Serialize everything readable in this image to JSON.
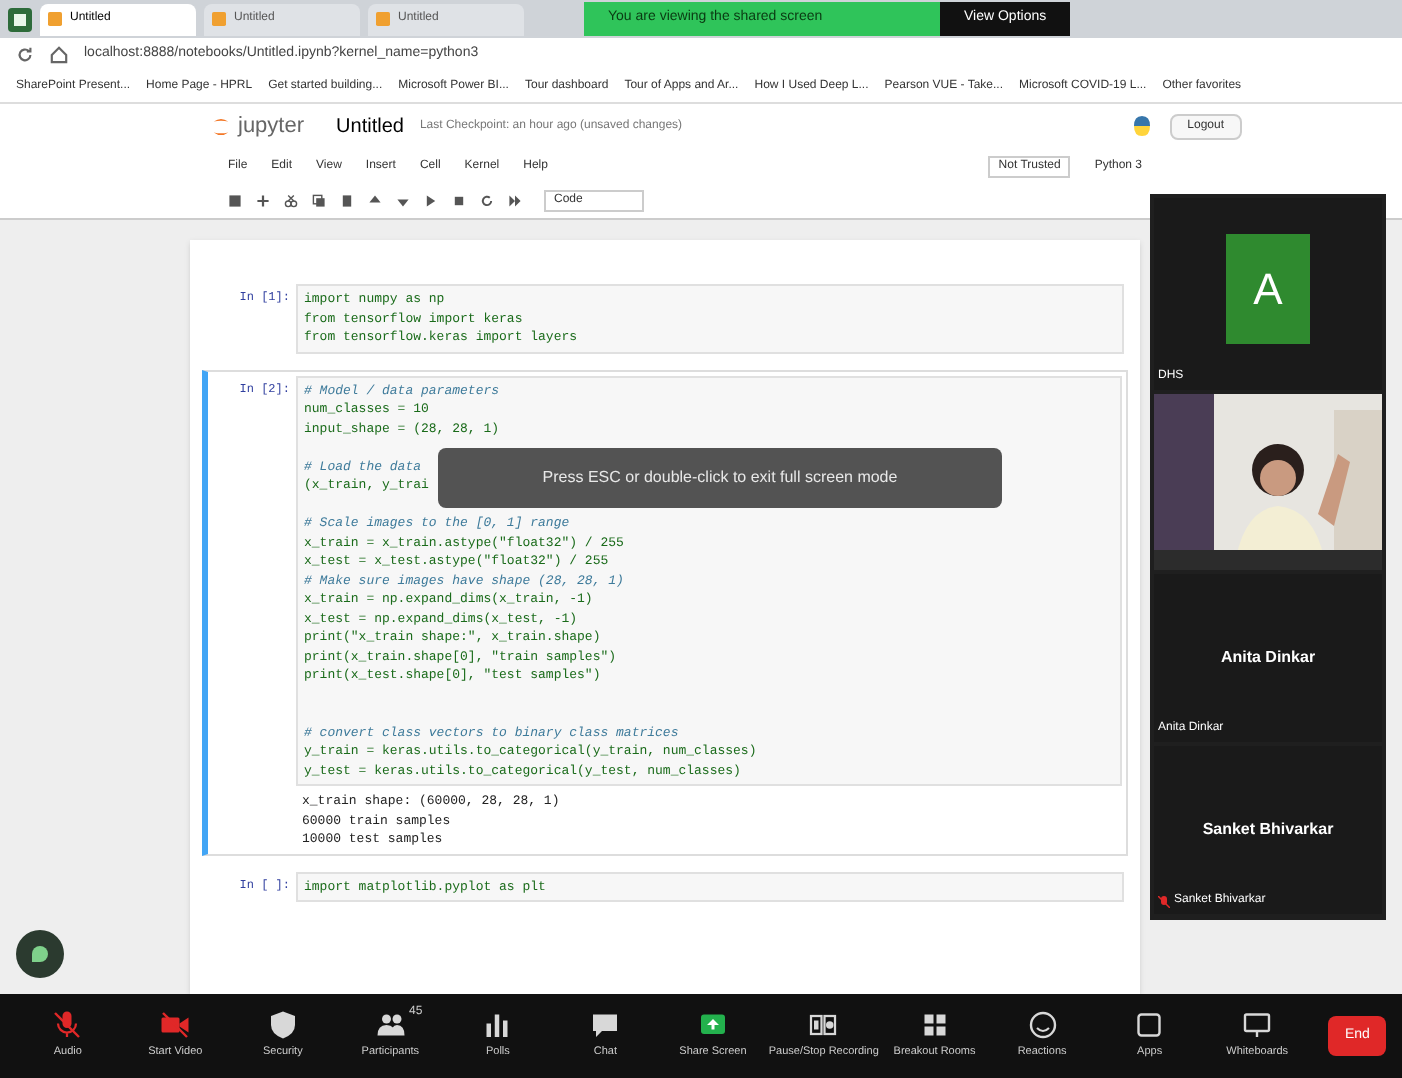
{
  "browser": {
    "tabs": [
      {
        "label": "Untitled",
        "selected": true
      },
      {
        "label": "Untitled",
        "selected": false
      },
      {
        "label": "Untitled",
        "selected": false
      }
    ],
    "address": "localhost:8888/notebooks/Untitled.ipynb?kernel_name=python3",
    "bookmarks": [
      "SharePoint Present...",
      "Home Page - HPRL",
      "Get started building...",
      "Microsoft Power BI...",
      "Tour dashboard",
      "Tour of Apps and Ar...",
      "How I Used Deep L...",
      "Pearson VUE - Take...",
      "Microsoft COVID-19 L...",
      "Other favorites"
    ]
  },
  "share_banner": {
    "text": "You are viewing the shared screen",
    "button": "View Options"
  },
  "notebook": {
    "logo": "jupyter",
    "title": "Untitled",
    "checkpoint": "Last Checkpoint: an hour ago  (unsaved changes)",
    "logout": "Logout",
    "menu": [
      "File",
      "Edit",
      "View",
      "Insert",
      "Cell",
      "Kernel",
      "Help"
    ],
    "trusted": "Not Trusted",
    "kernel": "Python 3",
    "cell_type": "Code",
    "cells": [
      {
        "prompt": "In [1]:",
        "selected": false,
        "lines": [
          {
            "kind": "code",
            "text": "import numpy as np"
          },
          {
            "kind": "code",
            "text": "from tensorflow import keras"
          },
          {
            "kind": "code",
            "text": "from tensorflow.keras import layers"
          }
        ]
      },
      {
        "prompt": "In [2]:",
        "selected": true,
        "lines": [
          {
            "kind": "comment",
            "text": "# Model / data parameters"
          },
          {
            "kind": "code",
            "text": "num_classes = 10"
          },
          {
            "kind": "code",
            "text": "input_shape = (28, 28, 1)"
          },
          {
            "kind": "blank"
          },
          {
            "kind": "comment",
            "text": "# Load the data "
          },
          {
            "kind": "code",
            "text": "(x_train, y_trai"
          },
          {
            "kind": "blank"
          },
          {
            "kind": "comment",
            "text": "# Scale images to the [0, 1] range"
          },
          {
            "kind": "code",
            "text": "x_train = x_train.astype(\"float32\") / 255"
          },
          {
            "kind": "code",
            "text": "x_test = x_test.astype(\"float32\") / 255"
          },
          {
            "kind": "comment",
            "text": "# Make sure images have shape (28, 28, 1)"
          },
          {
            "kind": "code",
            "text": "x_train = np.expand_dims(x_train, -1)"
          },
          {
            "kind": "code",
            "text": "x_test = np.expand_dims(x_test, -1)"
          },
          {
            "kind": "code",
            "text": "print(\"x_train shape:\", x_train.shape)"
          },
          {
            "kind": "code",
            "text": "print(x_train.shape[0], \"train samples\")"
          },
          {
            "kind": "code",
            "text": "print(x_test.shape[0], \"test samples\")"
          },
          {
            "kind": "blank"
          },
          {
            "kind": "blank"
          },
          {
            "kind": "comment",
            "text": "# convert class vectors to binary class matrices"
          },
          {
            "kind": "code",
            "text": "y_train = keras.utils.to_categorical(y_train, num_classes)"
          },
          {
            "kind": "code",
            "text": "y_test = keras.utils.to_categorical(y_test, num_classes)"
          }
        ],
        "output": [
          "x_train shape: (60000, 28, 28, 1)",
          "60000 train samples",
          "10000 test samples"
        ]
      },
      {
        "prompt": "In [ ]:",
        "selected": false,
        "lines": [
          {
            "kind": "code",
            "text": "import matplotlib.pyplot as plt"
          }
        ]
      }
    ]
  },
  "fullscreen_notice": "Press ESC or double-click to exit full screen mode",
  "participants": [
    {
      "kind": "avatar",
      "initial": "A",
      "color": "#2f8a2f",
      "label": "DHS"
    },
    {
      "kind": "video"
    },
    {
      "kind": "name",
      "name": "Anita Dinkar",
      "label": "Anita Dinkar",
      "muted": false
    },
    {
      "kind": "name",
      "name": "Sanket Bhivarkar",
      "label": "Sanket Bhivarkar",
      "muted": true
    }
  ],
  "meeting_toolbar": [
    {
      "label": "Audio",
      "muted": true
    },
    {
      "label": "Start Video",
      "muted": true
    },
    {
      "label": "Security",
      "muted": false
    },
    {
      "label": "Participants",
      "count": "45",
      "muted": false
    },
    {
      "label": "Polls",
      "muted": false
    },
    {
      "label": "Chat",
      "muted": false
    },
    {
      "label": "Share Screen",
      "muted": false
    },
    {
      "label": "Pause/Stop Recording",
      "muted": false
    },
    {
      "label": "Breakout Rooms",
      "muted": false
    },
    {
      "label": "Reactions",
      "muted": false
    },
    {
      "label": "Apps",
      "muted": false
    },
    {
      "label": "Whiteboards",
      "muted": false
    }
  ],
  "end_button": "End"
}
